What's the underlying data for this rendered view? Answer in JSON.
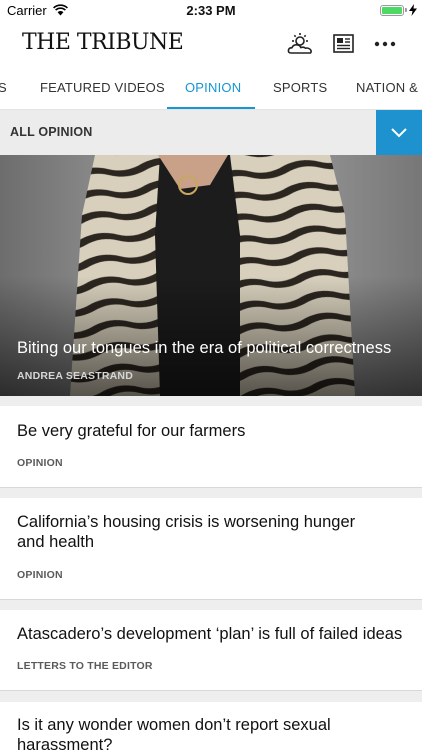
{
  "status_bar": {
    "carrier": "Carrier",
    "time": "2:33 PM"
  },
  "header": {
    "logo": "THE TRIBUNE",
    "icons": [
      "weather-icon",
      "newspaper-icon",
      "more-icon"
    ]
  },
  "tabs": [
    {
      "label": "S"
    },
    {
      "label": "FEATURED VIDEOS"
    },
    {
      "label": "OPINION",
      "active": true
    },
    {
      "label": "SPORTS"
    },
    {
      "label": "NATION & W"
    }
  ],
  "filter": {
    "label": "ALL OPINION",
    "icon": "chevron-down-icon"
  },
  "hero": {
    "title": "Biting our tongues in the era of political correctness",
    "byline": "ANDREA SEASTRAND"
  },
  "articles": [
    {
      "title": "Be very grateful for our farmers",
      "label": "OPINION"
    },
    {
      "title": "California’s housing crisis is worsening hunger and health",
      "label": "OPINION"
    },
    {
      "title": "Atascadero’s development ‘plan’ is full of failed ideas",
      "label": "LETTERS TO THE EDITOR"
    },
    {
      "title": "Is it any wonder women don’t report sexual harassment?",
      "label": ""
    }
  ],
  "colors": {
    "accent": "#1696d2",
    "dropdown": "#1d92cf",
    "battery": "#4cd964"
  }
}
